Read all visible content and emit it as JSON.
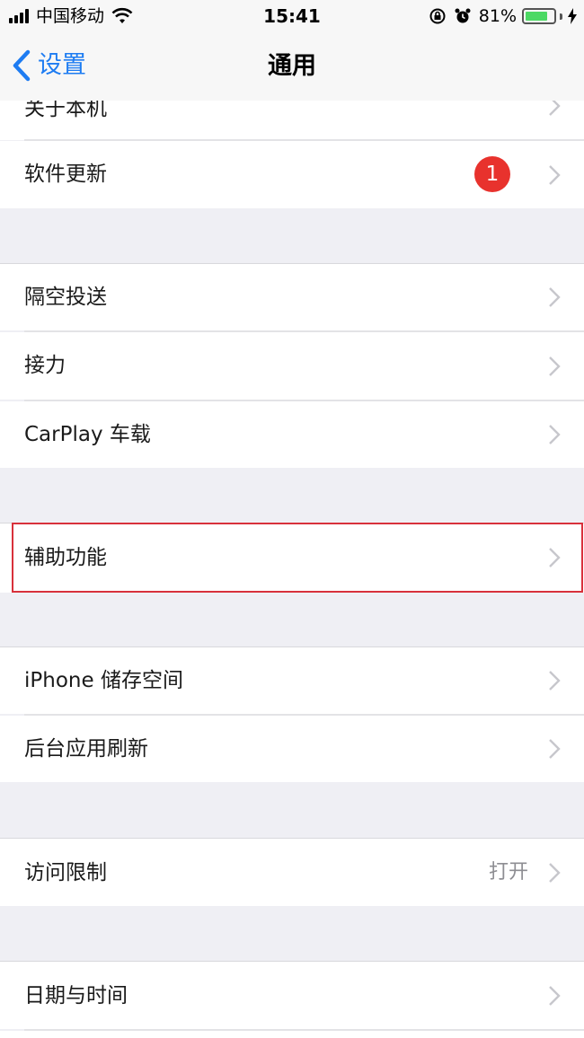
{
  "status_bar": {
    "carrier": "中国移动",
    "time": "15:41",
    "battery_percent": "81%",
    "battery_level": 0.81,
    "icons": [
      "signal-icon",
      "wifi-icon",
      "orientation-lock-icon",
      "alarm-icon",
      "battery-icon",
      "charging-bolt-icon"
    ]
  },
  "nav": {
    "back_label": "设置",
    "title": "通用"
  },
  "rows": {
    "about": "关于本机",
    "software_update": "软件更新",
    "software_update_badge": "1",
    "airdrop": "隔空投送",
    "handoff": "接力",
    "carplay": "CarPlay 车载",
    "accessibility": "辅助功能",
    "iphone_storage": "iPhone 储存空间",
    "background_refresh": "后台应用刷新",
    "restrictions": "访问限制",
    "restrictions_value": "打开",
    "date_time": "日期与时间"
  },
  "colors": {
    "accent": "#1e7cf2",
    "badge": "#e8322d",
    "highlight": "#d8313b",
    "battery": "#4cd964"
  }
}
